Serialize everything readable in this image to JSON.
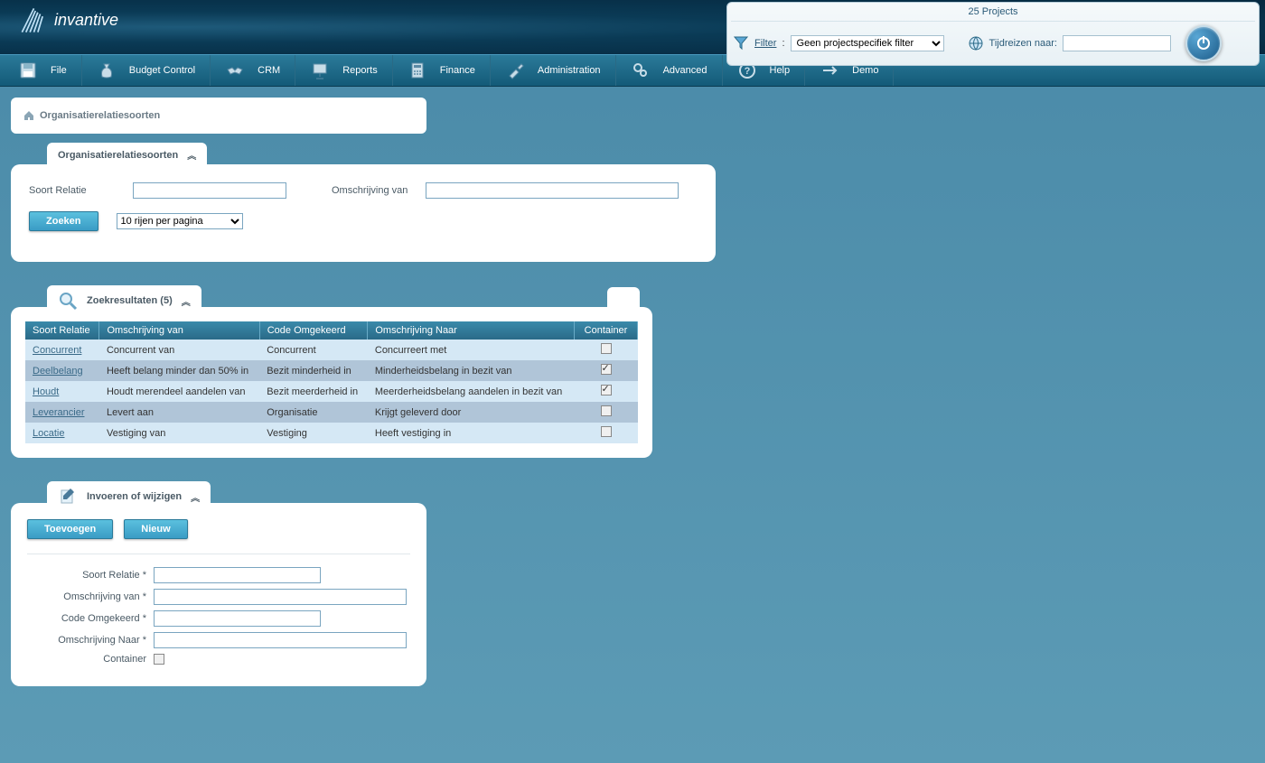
{
  "header": {
    "logo_text": "invantive",
    "projects_title": "25 Projects",
    "filter_label": "Filter",
    "filter_colon": " :",
    "filter_selected": "Geen projectspecifiek filter",
    "time_travel_label": "Tijdreizen naar:",
    "time_travel_value": ""
  },
  "menu": [
    {
      "label": "File"
    },
    {
      "label": "Budget Control"
    },
    {
      "label": "CRM"
    },
    {
      "label": "Reports"
    },
    {
      "label": "Finance"
    },
    {
      "label": "Administration"
    },
    {
      "label": "Advanced"
    },
    {
      "label": "Help"
    },
    {
      "label": "Demo"
    }
  ],
  "breadcrumb": {
    "title": "Organisatierelatiesoorten"
  },
  "search_panel": {
    "tab_title": "Organisatierelatiesoorten",
    "field1_label": "Soort Relatie",
    "field2_label": "Omschrijving van",
    "search_button": "Zoeken",
    "rows_per_page": "10 rijen per pagina"
  },
  "results_panel": {
    "tab_title": "Zoekresultaten (5)",
    "columns": [
      "Soort Relatie",
      "Omschrijving van",
      "Code Omgekeerd",
      "Omschrijving Naar",
      "Container"
    ],
    "rows": [
      {
        "soort": "Concurrent",
        "omschrijving_van": "Concurrent van",
        "code": "Concurrent",
        "omschrijving_naar": "Concurreert met",
        "container": false
      },
      {
        "soort": "Deelbelang",
        "omschrijving_van": "Heeft belang minder dan 50% in",
        "code": "Bezit minderheid in",
        "omschrijving_naar": "Minderheidsbelang in bezit van",
        "container": true
      },
      {
        "soort": "Houdt",
        "omschrijving_van": "Houdt merendeel aandelen van",
        "code": "Bezit meerderheid in",
        "omschrijving_naar": "Meerderheidsbelang aandelen in bezit van",
        "container": true
      },
      {
        "soort": "Leverancier",
        "omschrijving_van": "Levert aan",
        "code": "Organisatie",
        "omschrijving_naar": "Krijgt geleverd door",
        "container": false
      },
      {
        "soort": "Locatie",
        "omschrijving_van": "Vestiging van",
        "code": "Vestiging",
        "omschrijving_naar": "Heeft vestiging in",
        "container": false
      }
    ]
  },
  "edit_panel": {
    "tab_title": "Invoeren of wijzigen",
    "add_button": "Toevoegen",
    "new_button": "Nieuw",
    "fields": {
      "soort_relatie": "Soort Relatie *",
      "omschrijving_van": "Omschrijving van *",
      "code_omgekeerd": "Code Omgekeerd *",
      "omschrijving_naar": "Omschrijving Naar *",
      "container": "Container"
    }
  }
}
